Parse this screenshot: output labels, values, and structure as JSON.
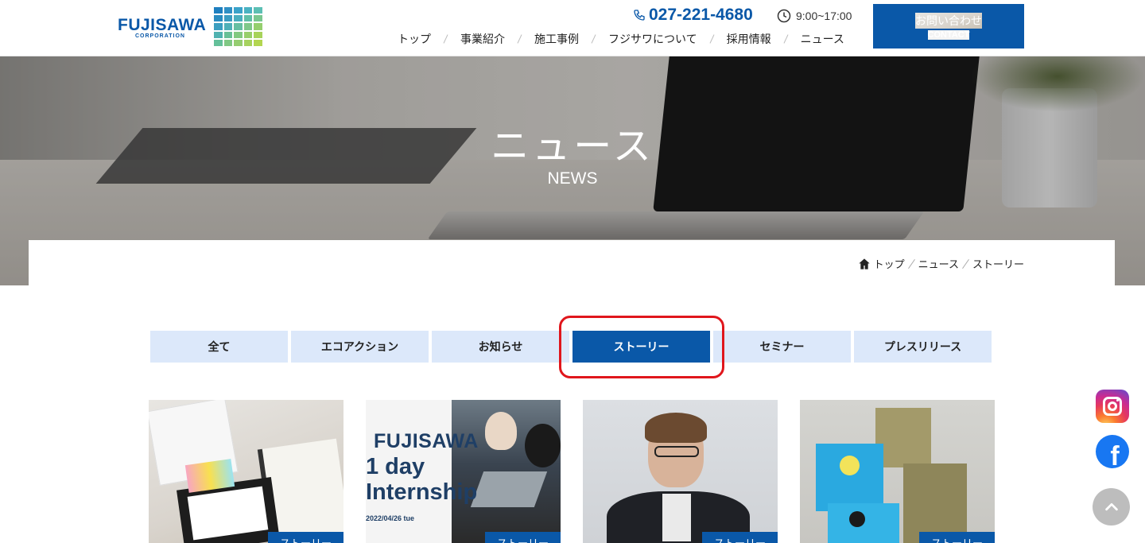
{
  "header": {
    "logo_text": "FUJISAWA",
    "logo_sub": "CORPORATION",
    "phone": "027-221-4680",
    "hours": "9:00~17:00",
    "contact_jp": "お問い合わせ",
    "contact_en": "CONTACT",
    "nav": [
      "トップ",
      "事業紹介",
      "施工事例",
      "フジサワについて",
      "採用情報",
      "ニュース"
    ]
  },
  "hero": {
    "title": "ニュース",
    "subtitle": "NEWS"
  },
  "breadcrumb": [
    "トップ",
    "ニュース",
    "ストーリー"
  ],
  "tabs": [
    "全て",
    "エコアクション",
    "お知らせ",
    "ストーリー",
    "セミナー",
    "プレスリリース"
  ],
  "active_tab": "ストーリー",
  "cards": [
    {
      "tag": "ストーリー"
    },
    {
      "tag": "ストーリー",
      "text_line1": "FUJISAWA",
      "text_line2": "1 day",
      "text_line3": "Internship",
      "date": "2022/04/26 tue"
    },
    {
      "tag": "ストーリー"
    },
    {
      "tag": "ストーリー"
    }
  ],
  "colors": {
    "brand_blue": "#0a58a8",
    "tab_bg": "#dce8fa",
    "highlight_red": "#e0161c"
  },
  "icons": {
    "phone": "phone-icon",
    "clock": "clock-icon",
    "home": "home-icon",
    "instagram": "instagram-icon",
    "facebook": "facebook-icon",
    "to_top": "chevron-up-icon"
  }
}
